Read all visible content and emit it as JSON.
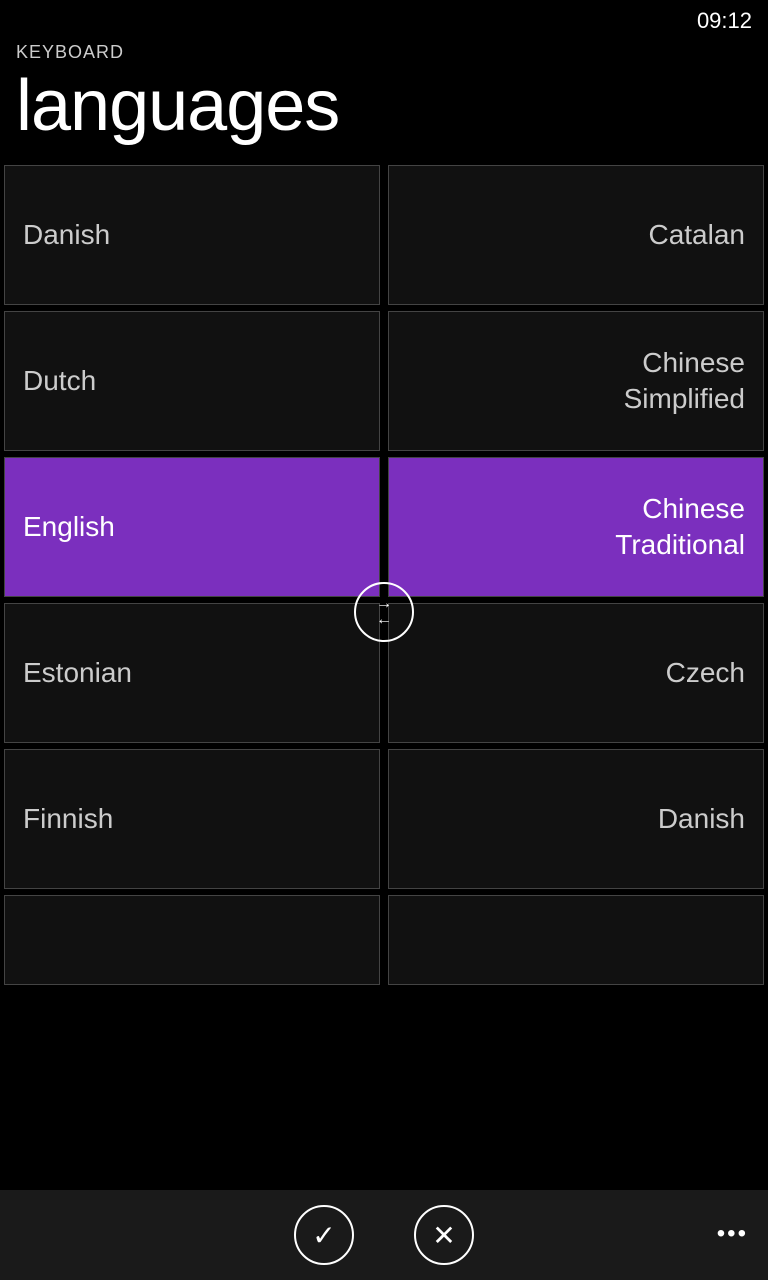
{
  "status": {
    "time": "09:12"
  },
  "header": {
    "subtitle": "KEYBOARD",
    "title": "languages"
  },
  "left_column": [
    {
      "id": "danish-left",
      "label": "Danish",
      "active": false
    },
    {
      "id": "dutch-left",
      "label": "Dutch",
      "active": false
    },
    {
      "id": "english-left",
      "label": "English",
      "active": true
    },
    {
      "id": "estonian-left",
      "label": "Estonian",
      "active": false
    },
    {
      "id": "finnish-left",
      "label": "Finnish",
      "active": false
    },
    {
      "id": "partial-left",
      "label": "",
      "active": false,
      "partial": true
    }
  ],
  "right_column": [
    {
      "id": "catalan-right",
      "label": "Catalan",
      "active": false
    },
    {
      "id": "chinese-simplified-right",
      "label": "Chinese\nSimplified",
      "active": false
    },
    {
      "id": "chinese-traditional-right",
      "label": "Chinese\nTraditional",
      "active": true
    },
    {
      "id": "czech-right",
      "label": "Czech",
      "active": false
    },
    {
      "id": "danish-right",
      "label": "Danish",
      "active": false
    },
    {
      "id": "partial-right",
      "label": "",
      "active": false,
      "partial": true
    }
  ],
  "swap_button": {
    "label": "⇄"
  },
  "bottom_bar": {
    "confirm_label": "✓",
    "cancel_label": "✕",
    "more_label": "•••"
  }
}
